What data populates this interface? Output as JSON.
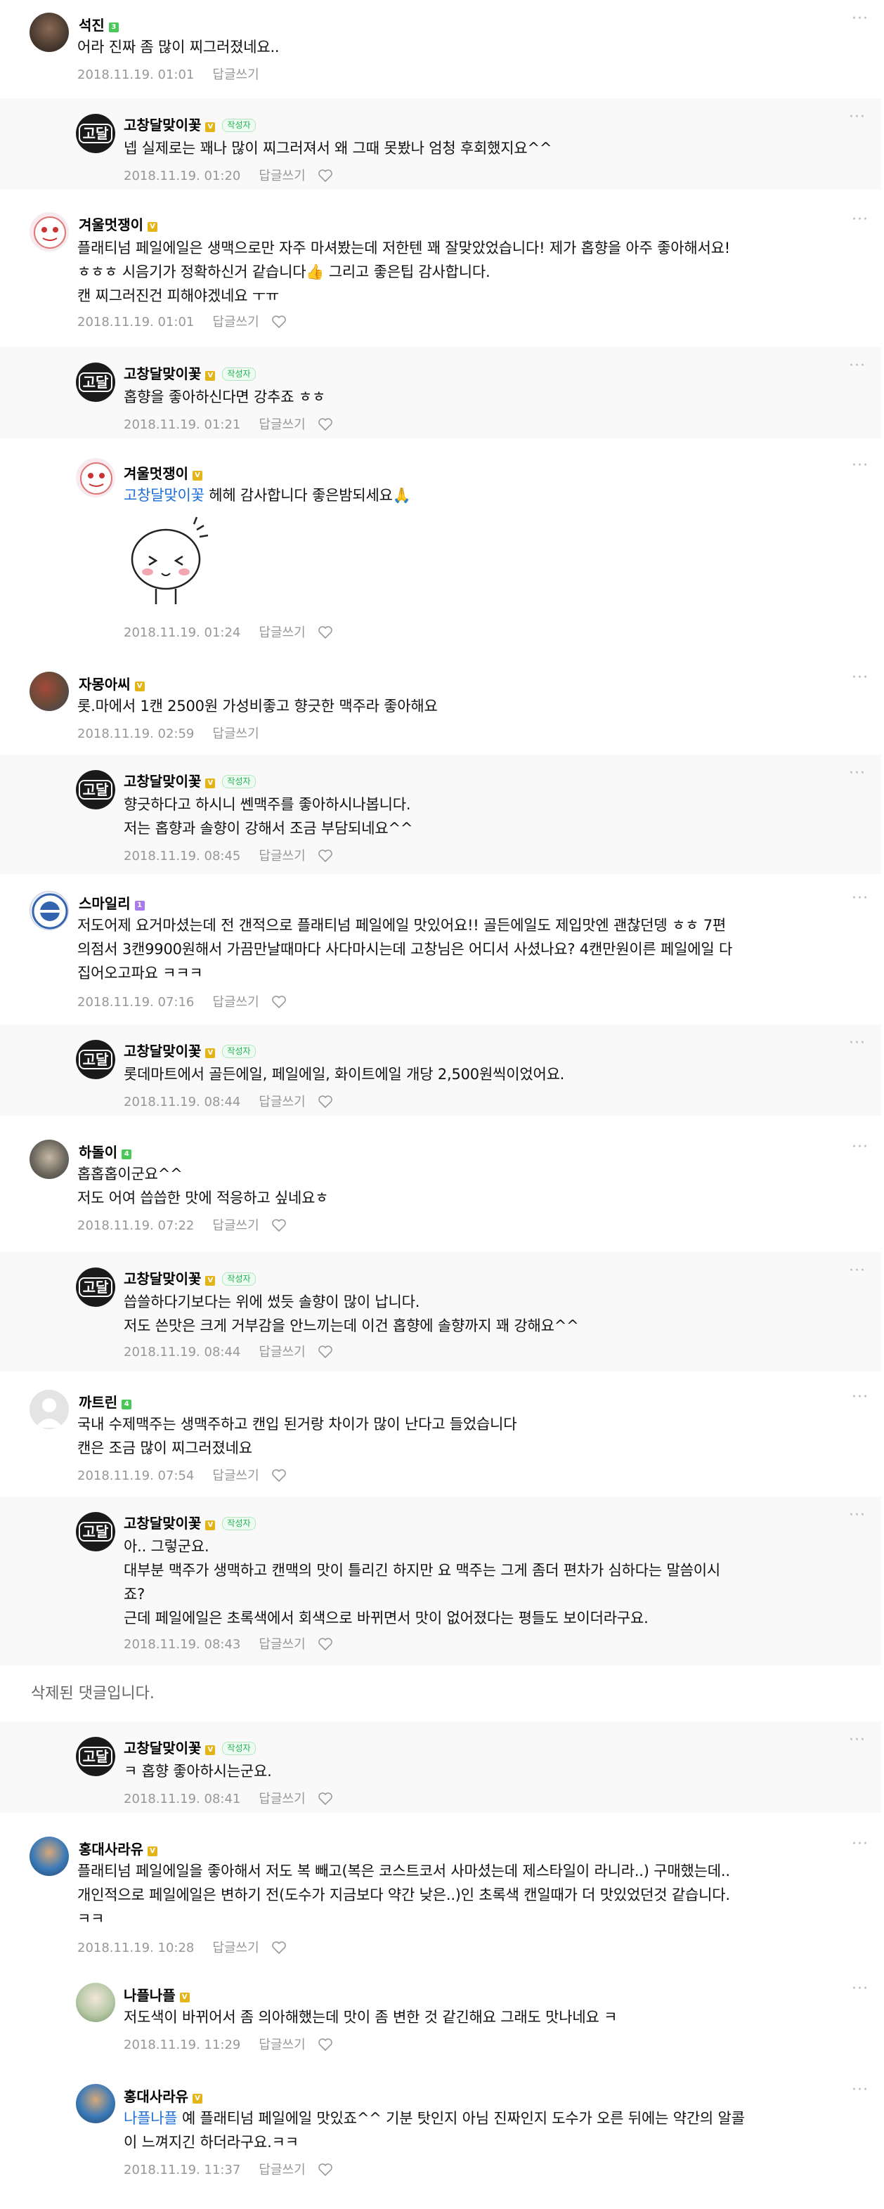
{
  "comments": [
    {
      "nick": "석진",
      "text": "어라 진짜 좀 많이 찌그러졌네요..",
      "date": "2018.11.19. 01:01",
      "reply_label": "답글쓰기"
    },
    {
      "nick": "고창달맞이꽃",
      "writer_tag": "작성자",
      "text": "넵 실제로는 꽤나 많이 찌그러져서 왜 그때 못봤나 엄청 후회했지요^^",
      "date": "2018.11.19. 01:20",
      "reply_label": "답글쓰기"
    },
    {
      "nick": "겨울멋쟁이",
      "text": "플래티넘 페일에일은 생맥으로만 자주 마셔봤는데 저한텐 꽤 잘맞았었습니다! 제가 홉향을 아주 좋아해서요!\nㅎㅎㅎ 시음기가 정확하신거 같습니다👍 그리고 좋은팁 감사합니다.\n캔 찌그러진건 피해야겠네요 ㅜㅠ",
      "date": "2018.11.19. 01:01",
      "reply_label": "답글쓰기"
    },
    {
      "nick": "고창달맞이꽃",
      "writer_tag": "작성자",
      "text": "홉향을 좋아하신다면 강추죠 ㅎㅎ",
      "date": "2018.11.19. 01:21",
      "reply_label": "답글쓰기"
    },
    {
      "nick": "겨울멋쟁이",
      "mention": "고창달맞이꽃",
      "text": " 헤헤 감사합니다 좋은밤되세요🙏",
      "date": "2018.11.19. 01:24",
      "reply_label": "답글쓰기"
    },
    {
      "nick": "자몽아씨",
      "text": "롯.마에서 1캔 2500원 가성비좋고 향긋한 맥주라 좋아해요",
      "date": "2018.11.19. 02:59",
      "reply_label": "답글쓰기"
    },
    {
      "nick": "고창달맞이꽃",
      "writer_tag": "작성자",
      "text": "향긋하다고 하시니 쎈맥주를 좋아하시나봅니다.\n저는 홉향과 솔향이 강해서 조금 부담되네요^^",
      "date": "2018.11.19. 08:45",
      "reply_label": "답글쓰기"
    },
    {
      "nick": "스마일리",
      "text": "저도어제 요거마셨는데 전 갠적으로 플래티넘 페일에일 맛있어요!! 골든에일도 제입맛엔 괜찮던뎅 ㅎㅎ 7편\n의점서 3캔9900원해서 가끔만날때마다 사다마시는데 고창님은 어디서 사셨나요? 4캔만원이른 페일에일 다\n집어오고파요 ㅋㅋㅋ",
      "date": "2018.11.19. 07:16",
      "reply_label": "답글쓰기"
    },
    {
      "nick": "고창달맞이꽃",
      "writer_tag": "작성자",
      "text": "롯데마트에서 골든에일, 페일에일, 화이트에일 개당 2,500원씩이었어요.",
      "date": "2018.11.19. 08:44",
      "reply_label": "답글쓰기"
    },
    {
      "nick": "하돌이",
      "text": "홉홉홉이군요^^\n저도 어여 씁씁한 맛에 적응하고 싶네요ㅎ",
      "date": "2018.11.19. 07:22",
      "reply_label": "답글쓰기"
    },
    {
      "nick": "고창달맞이꽃",
      "writer_tag": "작성자",
      "text": "씁쓸하다기보다는 위에 썼듯 솔향이 많이 납니다.\n저도 쓴맛은 크게 거부감을 안느끼는데 이건 홉향에 솔향까지 꽤 강해요^^",
      "date": "2018.11.19. 08:44",
      "reply_label": "답글쓰기"
    },
    {
      "nick": "까트린",
      "text": "국내 수제맥주는 생맥주하고 캔입 된거랑 차이가 많이 난다고 들었습니다\n캔은 조금 많이 찌그러졌네요",
      "date": "2018.11.19. 07:54",
      "reply_label": "답글쓰기"
    },
    {
      "nick": "고창달맞이꽃",
      "writer_tag": "작성자",
      "text": "아.. 그렇군요.\n대부분 맥주가 생맥하고 캔맥의 맛이 틀리긴 하지만 요 맥주는 그게 좀더 편차가 심하다는 말씀이시\n죠?\n근데 페일에일은 초록색에서 회색으로 바뀌면서 맛이 없어졌다는 평들도 보이더라구요.",
      "date": "2018.11.19. 08:43",
      "reply_label": "답글쓰기"
    },
    {
      "deleted_text": "삭제된 댓글입니다."
    },
    {
      "nick": "고창달맞이꽃",
      "writer_tag": "작성자",
      "text": "ㅋ 홉향 좋아하시는군요.",
      "date": "2018.11.19. 08:41",
      "reply_label": "답글쓰기"
    },
    {
      "nick": "홍대사라유",
      "text": "플래티넘 페일에일을 좋아해서 저도 복 빼고(복은 코스트코서 사마셨는데 제스타일이 라니라..) 구매했는데..\n개인적으로 페일에일은 변하기 전(도수가 지금보다 약간 낮은..)인 초록색 캔일때가 더 맛있었던것 같습니다.\nㅋㅋ",
      "date": "2018.11.19. 10:28",
      "reply_label": "답글쓰기"
    },
    {
      "nick": "나플나플",
      "text": "저도색이 바뀌어서 좀 의아해했는데 맛이 좀 변한 것 같긴해요 그래도 맛나네요 ㅋ",
      "date": "2018.11.19. 11:29",
      "reply_label": "답글쓰기"
    },
    {
      "nick": "홍대사라유",
      "mention": "나플나플",
      "text": " 예 플래티넘 페일에일 맛있죠^^ 기분 탓인지 아님 진짜인지 도수가 오른 뒤에는 약간의 알콜\n이 느껴지긴 하더라구요.ㅋㅋ",
      "date": "2018.11.19. 11:37",
      "reply_label": "답글쓰기"
    }
  ],
  "more_label": "···",
  "badges": {
    "c0": "3",
    "c2": "V",
    "c4": "V",
    "c5": "V",
    "c7": "1",
    "c9": "4",
    "c11": "4",
    "c15": "V",
    "c16": "V",
    "c17": "V"
  },
  "logo_text": "고달",
  "colors": {
    "mention": "#1e6fd9",
    "reply_bg": "#f9f9fa",
    "writer_tag": "#21b54e"
  }
}
